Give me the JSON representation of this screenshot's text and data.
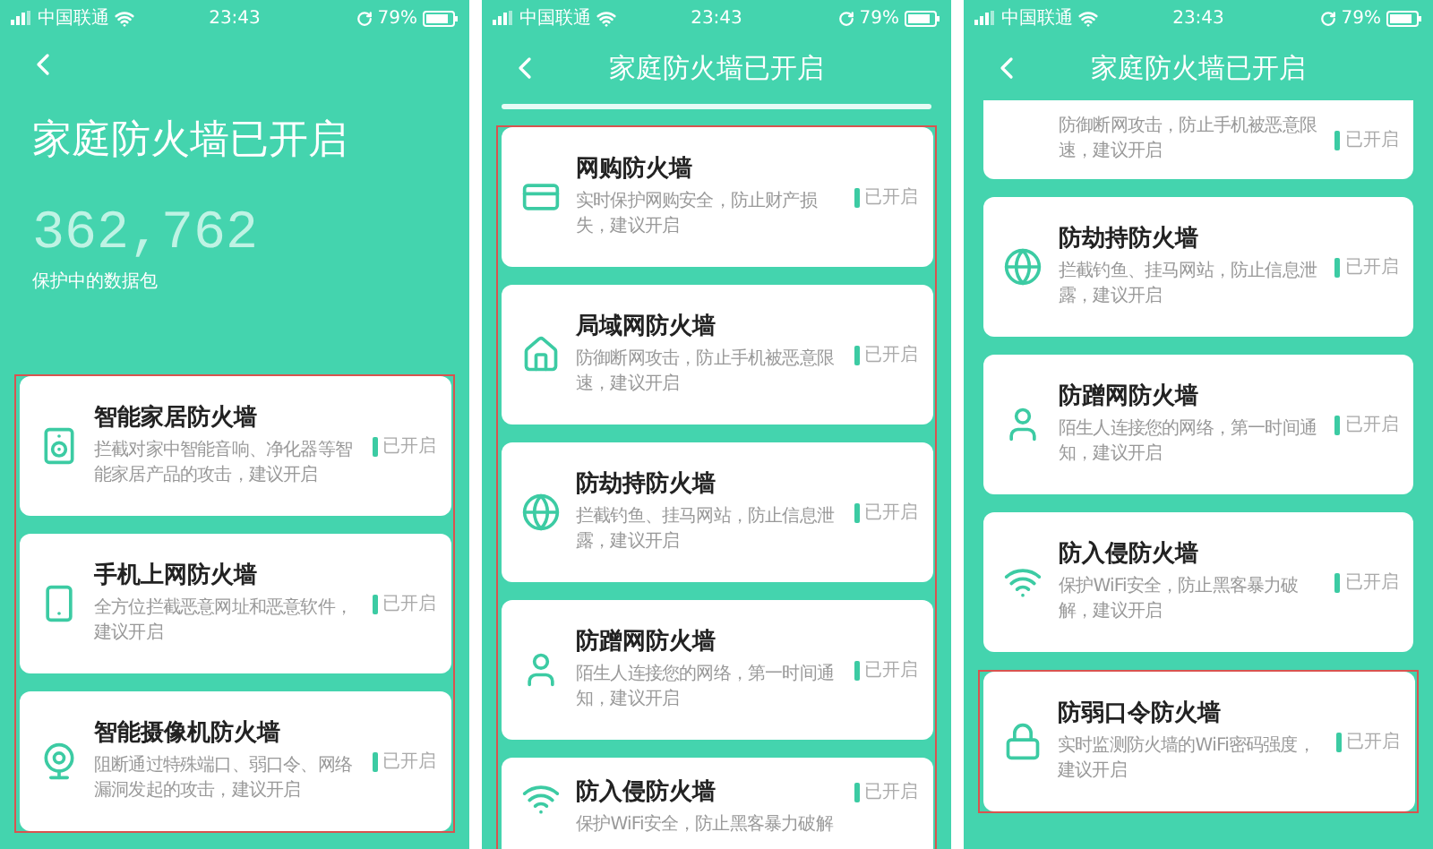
{
  "screens": [
    {
      "status_bar": {
        "carrier": "中国联通",
        "time": "23:43",
        "battery": "79%"
      },
      "hero": {
        "title": "家庭防火墙已开启",
        "count": "362,762",
        "caption": "保护中的数据包"
      },
      "cards": [
        {
          "kind": "home-device",
          "title": "智能家居防火墙",
          "description": "拦截对家中智能音响、净化器等智能家居产品的攻击，建议开启",
          "status": "已开启",
          "on": true,
          "highlighted": true
        },
        {
          "kind": "mobile",
          "title": "手机上网防火墙",
          "description": "全方位拦截恶意网址和恶意软件，建议开启",
          "status": "已开启",
          "on": true,
          "highlighted": true
        },
        {
          "kind": "camera",
          "title": "智能摄像机防火墙",
          "description": "阻断通过特殊端口、弱口令、网络漏洞发起的攻击，建议开启",
          "status": "已开启",
          "on": true,
          "highlighted": true
        }
      ]
    },
    {
      "status_bar": {
        "carrier": "中国联通",
        "time": "23:43",
        "battery": "79%"
      },
      "header": {
        "title": "家庭防火墙已开启"
      },
      "cards": [
        {
          "kind": "shopping",
          "title": "网购防火墙",
          "description": "实时保护网购安全，防止财产损失，建议开启",
          "status": "已开启",
          "on": true,
          "highlighted": true
        },
        {
          "kind": "lan",
          "title": "局域网防火墙",
          "description": "防御断网攻击，防止手机被恶意限速，建议开启",
          "status": "已开启",
          "on": true,
          "highlighted": true
        },
        {
          "kind": "hijack",
          "title": "防劫持防火墙",
          "description": "拦截钓鱼、挂马网站，防止信息泄露，建议开启",
          "status": "已开启",
          "on": true,
          "highlighted": true
        },
        {
          "kind": "stranger",
          "title": "防蹭网防火墙",
          "description": "陌生人连接您的网络，第一时间通知，建议开启",
          "status": "已开启",
          "on": true,
          "highlighted": true
        },
        {
          "kind": "intrusion",
          "title": "防入侵防火墙",
          "description": "保护WiFi安全，防止黑客暴力破解",
          "status": "已开启",
          "on": true,
          "highlighted": true
        }
      ]
    },
    {
      "status_bar": {
        "carrier": "中国联通",
        "time": "23:43",
        "battery": "79%"
      },
      "header": {
        "title": "家庭防火墙已开启"
      },
      "cards": [
        {
          "kind": "partial",
          "description": "防御断网攻击，防止手机被恶意限速，建议开启",
          "status": "已开启",
          "on": true,
          "highlighted": false
        },
        {
          "kind": "hijack",
          "title": "防劫持防火墙",
          "description": "拦截钓鱼、挂马网站，防止信息泄露，建议开启",
          "status": "已开启",
          "on": true,
          "highlighted": false
        },
        {
          "kind": "stranger",
          "title": "防蹭网防火墙",
          "description": "陌生人连接您的网络，第一时间通知，建议开启",
          "status": "已开启",
          "on": true,
          "highlighted": false
        },
        {
          "kind": "intrusion",
          "title": "防入侵防火墙",
          "description": "保护WiFi安全，防止黑客暴力破解，建议开启",
          "status": "已开启",
          "on": true,
          "highlighted": false
        },
        {
          "kind": "password",
          "title": "防弱口令防火墙",
          "description": "实时监测防火墙的WiFi密码强度，建议开启",
          "status": "已开启",
          "on": true,
          "highlighted": true
        }
      ]
    }
  ]
}
